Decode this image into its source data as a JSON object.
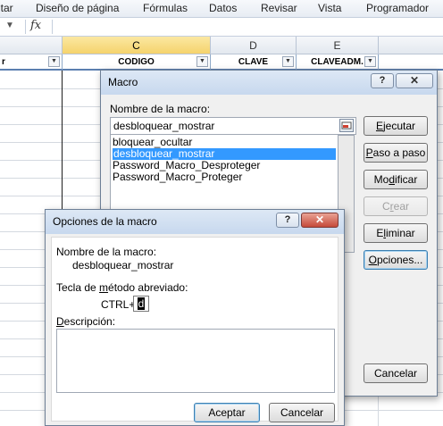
{
  "ribbon": {
    "tabs": [
      "ntar",
      "Diseño de página",
      "Fórmulas",
      "Datos",
      "Revisar",
      "Vista",
      "Programador"
    ]
  },
  "formula_bar": {
    "fx_label": "fx"
  },
  "columns": {
    "c": "C",
    "d": "D",
    "e": "E"
  },
  "table_headers": {
    "first": "r",
    "codigo": "CODIGO",
    "clave": "CLAVE",
    "claveadm": "CLAVEADM."
  },
  "macro_dialog": {
    "title": "Macro",
    "help": "?",
    "close": "✕",
    "name_label": "Nombre de la macro:",
    "name_value": "desbloquear_mostrar",
    "items": [
      "bloquear_ocultar",
      "desbloquear_mostrar",
      "Password_Macro_Desproteger",
      "Password_Macro_Proteger"
    ],
    "selected_index": 1,
    "buttons": {
      "ejecutar": "Ejecutar",
      "paso": "Paso a paso",
      "modificar": "Modificar",
      "crear": "Crear",
      "eliminar": "Eliminar",
      "opciones": "Opciones...",
      "cancelar": "Cancelar"
    }
  },
  "options_dialog": {
    "title": "Opciones de la macro",
    "help": "?",
    "close": "✕",
    "name_label": "Nombre de la macro:",
    "name_value": "desbloquear_mostrar",
    "shortcut_label": "Tecla de método abreviado:",
    "ctrl_label": "CTRL+",
    "shortcut_value": "d",
    "description_label": "Descripción:",
    "description_value": "",
    "buttons": {
      "accept": "Aceptar",
      "cancel": "Cancelar"
    }
  }
}
